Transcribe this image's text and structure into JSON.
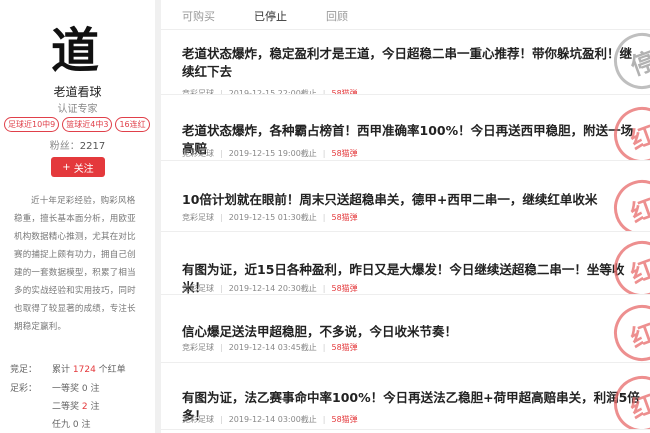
{
  "expert": {
    "avatar_char": "道",
    "name": "老道看球",
    "role": "认证专家",
    "tags": [
      "足球近10中9",
      "篮球近4中3",
      "16连红"
    ],
    "fans_label": "粉丝：",
    "fans_count": "2217",
    "follow_label": "关注",
    "bio": "近十年足彩经验，购彩风格稳重，擅长基本面分析，用欧亚机构数据精心推测，尤其在对比赛的捕捉上颇有功力，拥自己创建的一套数据模型，积累了相当多的实战经验和实用技巧，同时也取得了较显著的成绩，专注长期稳定赢利。"
  },
  "stats": {
    "jingcai_label": "竞足：",
    "jingcai_prefix": "累计",
    "jingcai_count": "1724",
    "jingcai_suffix": "个红单",
    "zucai_label": "足彩：",
    "first_prize_label": "一等奖",
    "first_prize_count": "0",
    "first_prize_suffix": "注",
    "second_prize_label": "二等奖",
    "second_prize_count": "2",
    "second_prize_suffix": "注",
    "ren9_label": "任九",
    "ren9_count": "0",
    "ren9_suffix": "注"
  },
  "tabs": [
    "可购买",
    "已停止",
    "回顾"
  ],
  "active_tab": "已停止",
  "items": [
    {
      "title": "老道状态爆炸，稳定盈利才是王道，今日超稳二串一重心推荐！带你躲坑盈利！继续红下去",
      "category": "竞彩足球",
      "time": "2019-12-15 22:00截止",
      "price": "58猫弹",
      "stamp": "停",
      "stamp_style": "grey"
    },
    {
      "title": "老道状态爆炸，各种霸占榜首！西甲准确率100%！今日再送西甲稳胆，附送一场高赔",
      "category": "竞彩足球",
      "time": "2019-12-15 19:00截止",
      "price": "58猫弹",
      "stamp": "红",
      "stamp_style": "red"
    },
    {
      "title": "10倍计划就在眼前！周末只送超稳串关，德甲+西甲二串一，继续红单收米",
      "category": "竞彩足球",
      "time": "2019-12-15 01:30截止",
      "price": "58猫弹",
      "stamp": "红",
      "stamp_style": "red"
    },
    {
      "title": "有图为证，近15日各种盈利，昨日又是大爆发！今日继续送超稳二串一！坐等收米！",
      "category": "竞彩足球",
      "time": "2019-12-14 20:30截止",
      "price": "58猫弹",
      "stamp": "红",
      "stamp_style": "red"
    },
    {
      "title": "信心爆足送法甲超稳胆，不多说，今日收米节奏！",
      "category": "竞彩足球",
      "time": "2019-12-14 03:45截止",
      "price": "58猫弹",
      "stamp": "红",
      "stamp_style": "red"
    },
    {
      "title": "有图为证，法乙赛事命中率100%！今日再送法乙稳胆+荷甲超高赔串关，利润5倍多！",
      "category": "竞彩足球",
      "time": "2019-12-14 03:00截止",
      "price": "58猫弹",
      "stamp": "红",
      "stamp_style": "red"
    }
  ]
}
